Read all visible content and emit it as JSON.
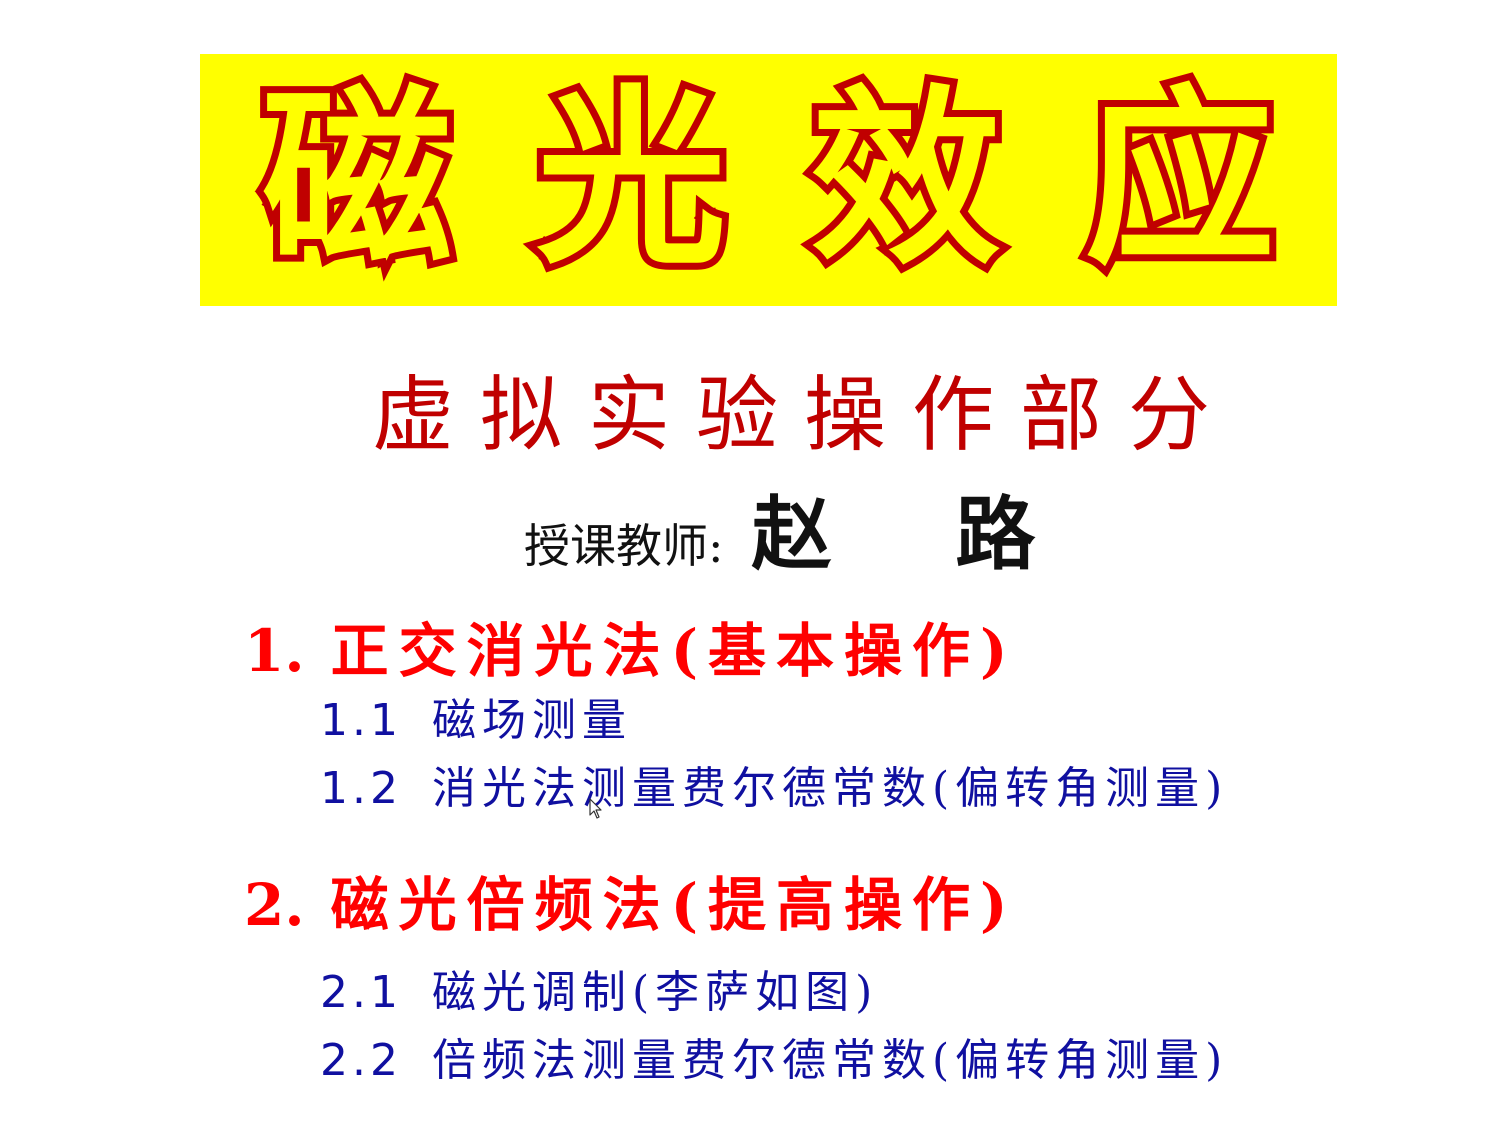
{
  "title": {
    "chars": [
      "磁",
      "光",
      "效",
      "应"
    ]
  },
  "subtitle": "虚拟实验操作部分",
  "teacher": {
    "label": "授课教师:",
    "name": "赵 路"
  },
  "sections": [
    {
      "number": "1.",
      "title": "正交消光法(基本操作)",
      "items": [
        {
          "number": "1.1",
          "text": "磁场测量"
        },
        {
          "number": "1.2",
          "text": "消光法测量费尔德常数(偏转角测量)"
        }
      ]
    },
    {
      "number": "2.",
      "title": "磁光倍频法(提高操作)",
      "items": [
        {
          "number": "2.1",
          "text": "磁光调制(李萨如图)"
        },
        {
          "number": "2.2",
          "text": "倍频法测量费尔德常数(偏转角测量)"
        }
      ]
    }
  ],
  "colors": {
    "banner_bg": "#ffff00",
    "title_stroke": "#c00000",
    "subtitle": "#c00000",
    "section_heading": "#ff0000",
    "sub_item": "#1010a0"
  },
  "icons": {
    "cursor": "mouse-pointer-icon"
  }
}
